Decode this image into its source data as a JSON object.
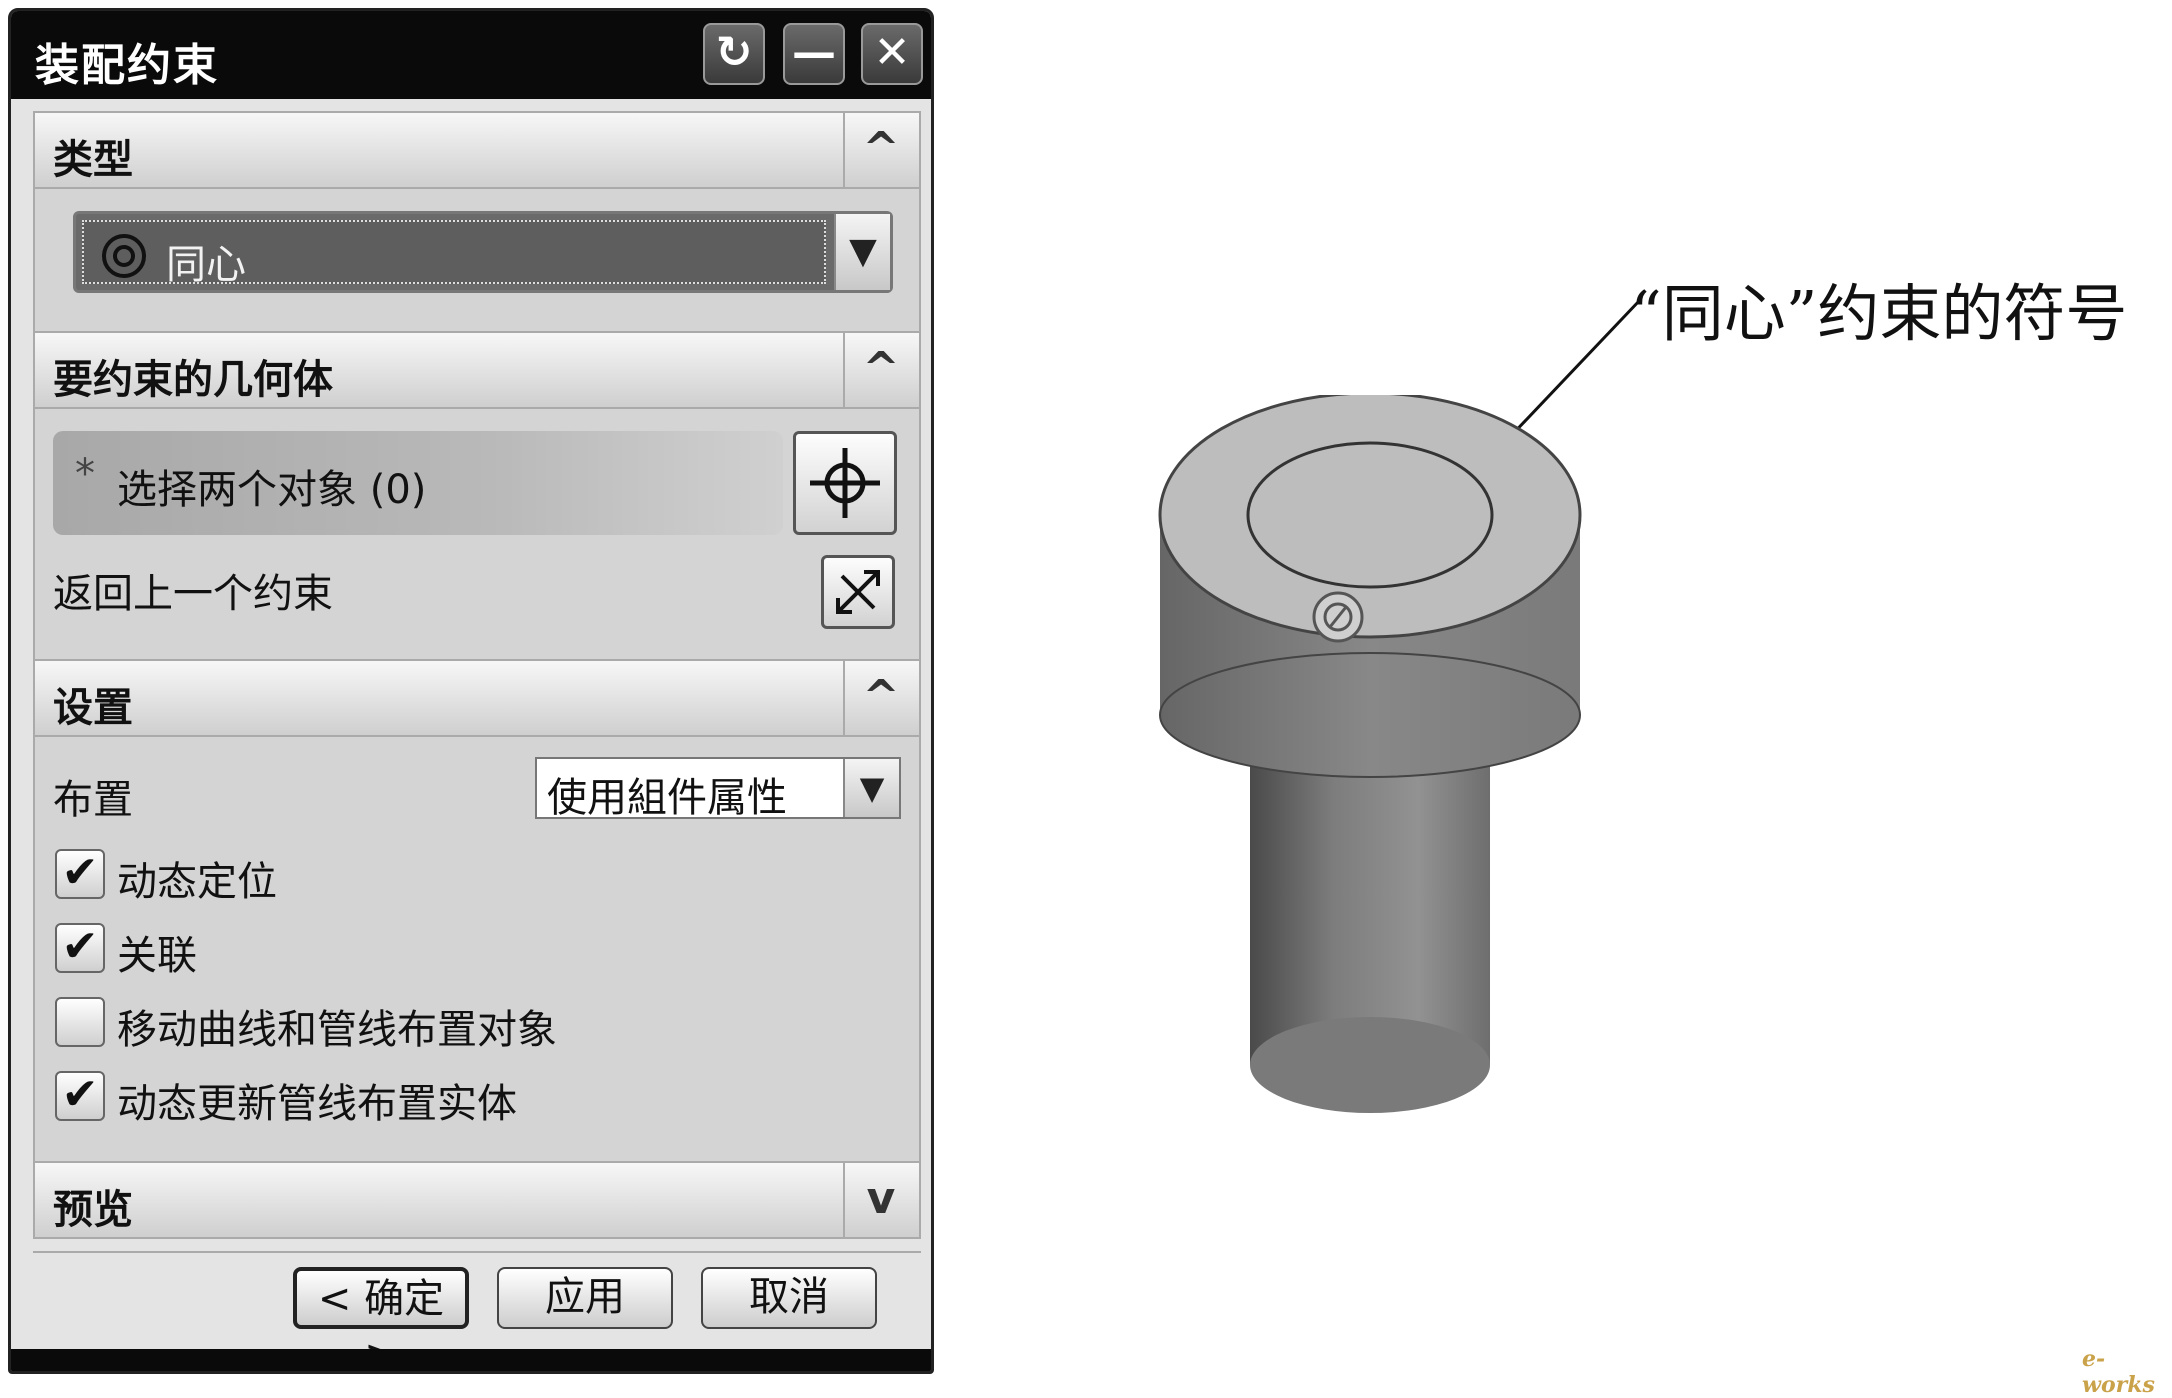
{
  "dialog": {
    "title": "装配约束",
    "titlebar_buttons": [
      {
        "icon": "reset-icon",
        "glyph": "↻"
      },
      {
        "icon": "minimize-icon",
        "glyph": "—"
      },
      {
        "icon": "close-icon",
        "glyph": "✕"
      }
    ],
    "sections": {
      "type": {
        "label": "类型",
        "arrow": "^",
        "selected_value": "同心",
        "selected_icon": "concentric-icon"
      },
      "geometry": {
        "label": "要约束的几何体",
        "arrow": "^",
        "select_star": "*",
        "select_text": "选择两个对象 (0)",
        "select_icon": "crosshair-icon",
        "reverse_label": "返回上一个约束",
        "reverse_icon": "reverse-direction-icon"
      },
      "settings": {
        "label": "设置",
        "arrow": "^",
        "placement_label": "布置",
        "placement_value": "使用組件属性",
        "checkboxes": [
          {
            "label": "动态定位",
            "checked": true,
            "mark": "✔"
          },
          {
            "label": "关联",
            "checked": true,
            "mark": "✔"
          },
          {
            "label": "移动曲线和管线布置对象",
            "checked": false,
            "mark": ""
          },
          {
            "label": "动态更新管线布置实体",
            "checked": true,
            "mark": "✔"
          }
        ]
      },
      "preview": {
        "label": "预览",
        "arrow": "v"
      }
    },
    "buttons": {
      "ok": "< 确定 >",
      "apply": "应用",
      "cancel": "取消"
    }
  },
  "annotation": {
    "text": "“同心”约束的符号"
  },
  "watermark": "e-works",
  "colors": {
    "titlebar": "#0a0a0a",
    "dialog_bg": "#e4e4e4",
    "section_body": "#d4d4d4",
    "selected_field": "#6a6a6a"
  }
}
